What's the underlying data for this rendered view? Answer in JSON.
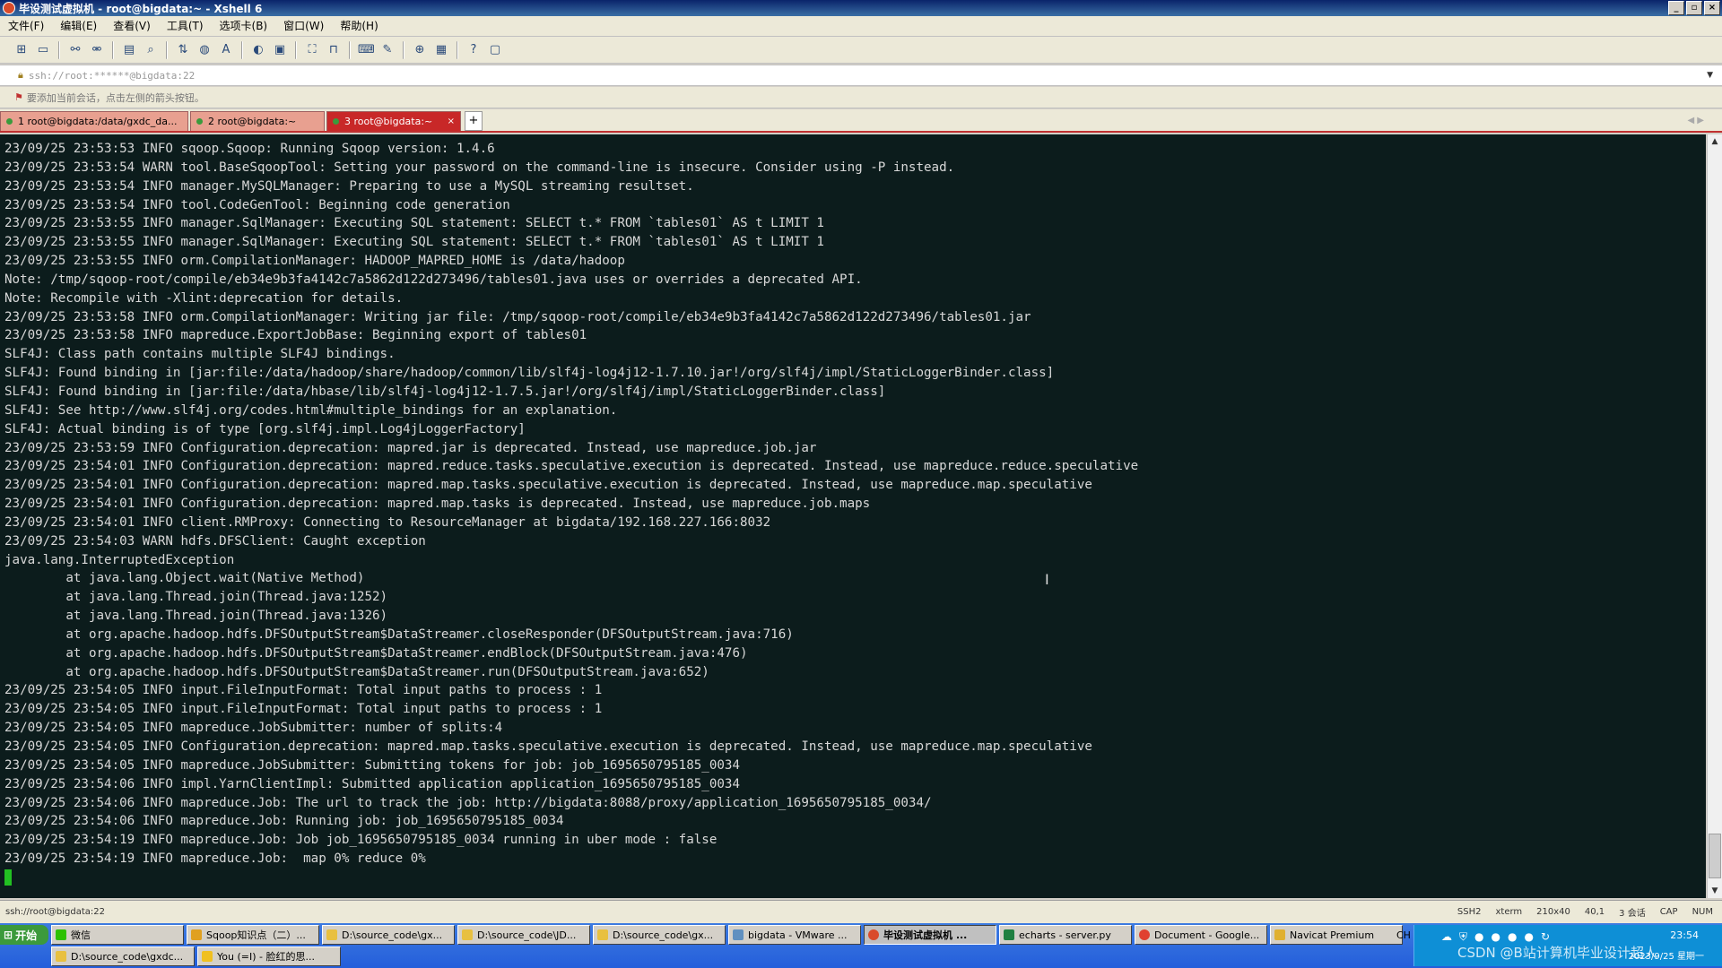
{
  "window": {
    "title": "毕设测试虚拟机 - root@bigdata:~ - Xshell 6",
    "minimize": "_",
    "maximize": "▫",
    "close": "×"
  },
  "menu": [
    "文件(F)",
    "编辑(E)",
    "查看(V)",
    "工具(T)",
    "选项卡(B)",
    "窗口(W)",
    "帮助(H)"
  ],
  "address": {
    "value": "ssh://root:******@bigdata:22"
  },
  "hint": {
    "text": "要添加当前会话，点击左侧的箭头按钮。"
  },
  "tabs": [
    {
      "label": "1 root@bigdata:/data/gxdc_da..."
    },
    {
      "label": "2 root@bigdata:~"
    },
    {
      "label": "3 root@bigdata:~",
      "close": "×"
    }
  ],
  "tab_add": "+",
  "terminal_lines": [
    "23/09/25 23:53:53 INFO sqoop.Sqoop: Running Sqoop version: 1.4.6",
    "23/09/25 23:53:54 WARN tool.BaseSqoopTool: Setting your password on the command-line is insecure. Consider using -P instead.",
    "23/09/25 23:53:54 INFO manager.MySQLManager: Preparing to use a MySQL streaming resultset.",
    "23/09/25 23:53:54 INFO tool.CodeGenTool: Beginning code generation",
    "23/09/25 23:53:55 INFO manager.SqlManager: Executing SQL statement: SELECT t.* FROM `tables01` AS t LIMIT 1",
    "23/09/25 23:53:55 INFO manager.SqlManager: Executing SQL statement: SELECT t.* FROM `tables01` AS t LIMIT 1",
    "23/09/25 23:53:55 INFO orm.CompilationManager: HADOOP_MAPRED_HOME is /data/hadoop",
    "Note: /tmp/sqoop-root/compile/eb34e9b3fa4142c7a5862d122d273496/tables01.java uses or overrides a deprecated API.",
    "Note: Recompile with -Xlint:deprecation for details.",
    "23/09/25 23:53:58 INFO orm.CompilationManager: Writing jar file: /tmp/sqoop-root/compile/eb34e9b3fa4142c7a5862d122d273496/tables01.jar",
    "23/09/25 23:53:58 INFO mapreduce.ExportJobBase: Beginning export of tables01",
    "SLF4J: Class path contains multiple SLF4J bindings.",
    "SLF4J: Found binding in [jar:file:/data/hadoop/share/hadoop/common/lib/slf4j-log4j12-1.7.10.jar!/org/slf4j/impl/StaticLoggerBinder.class]",
    "SLF4J: Found binding in [jar:file:/data/hbase/lib/slf4j-log4j12-1.7.5.jar!/org/slf4j/impl/StaticLoggerBinder.class]",
    "SLF4J: See http://www.slf4j.org/codes.html#multiple_bindings for an explanation.",
    "SLF4J: Actual binding is of type [org.slf4j.impl.Log4jLoggerFactory]",
    "23/09/25 23:53:59 INFO Configuration.deprecation: mapred.jar is deprecated. Instead, use mapreduce.job.jar",
    "23/09/25 23:54:01 INFO Configuration.deprecation: mapred.reduce.tasks.speculative.execution is deprecated. Instead, use mapreduce.reduce.speculative",
    "23/09/25 23:54:01 INFO Configuration.deprecation: mapred.map.tasks.speculative.execution is deprecated. Instead, use mapreduce.map.speculative",
    "23/09/25 23:54:01 INFO Configuration.deprecation: mapred.map.tasks is deprecated. Instead, use mapreduce.job.maps",
    "23/09/25 23:54:01 INFO client.RMProxy: Connecting to ResourceManager at bigdata/192.168.227.166:8032",
    "23/09/25 23:54:03 WARN hdfs.DFSClient: Caught exception",
    "java.lang.InterruptedException",
    "        at java.lang.Object.wait(Native Method)",
    "        at java.lang.Thread.join(Thread.java:1252)",
    "        at java.lang.Thread.join(Thread.java:1326)",
    "        at org.apache.hadoop.hdfs.DFSOutputStream$DataStreamer.closeResponder(DFSOutputStream.java:716)",
    "        at org.apache.hadoop.hdfs.DFSOutputStream$DataStreamer.endBlock(DFSOutputStream.java:476)",
    "        at org.apache.hadoop.hdfs.DFSOutputStream$DataStreamer.run(DFSOutputStream.java:652)",
    "23/09/25 23:54:05 INFO input.FileInputFormat: Total input paths to process : 1",
    "23/09/25 23:54:05 INFO input.FileInputFormat: Total input paths to process : 1",
    "23/09/25 23:54:05 INFO mapreduce.JobSubmitter: number of splits:4",
    "23/09/25 23:54:05 INFO Configuration.deprecation: mapred.map.tasks.speculative.execution is deprecated. Instead, use mapreduce.map.speculative",
    "23/09/25 23:54:05 INFO mapreduce.JobSubmitter: Submitting tokens for job: job_1695650795185_0034",
    "23/09/25 23:54:06 INFO impl.YarnClientImpl: Submitted application application_1695650795185_0034",
    "23/09/25 23:54:06 INFO mapreduce.Job: The url to track the job: http://bigdata:8088/proxy/application_1695650795185_0034/",
    "23/09/25 23:54:06 INFO mapreduce.Job: Running job: job_1695650795185_0034",
    "23/09/25 23:54:19 INFO mapreduce.Job: Job job_1695650795185_0034 running in uber mode : false",
    "23/09/25 23:54:19 INFO mapreduce.Job:  map 0% reduce 0%"
  ],
  "status": {
    "address": "ssh://root@bigdata:22",
    "items": [
      "SSH2",
      "xterm",
      "210x40",
      "40,1",
      "3 会话",
      "CAP",
      "NUM"
    ]
  },
  "taskbar": {
    "start": "开始",
    "row1": [
      "微信",
      "Sqoop知识点（二）...",
      "D:\\source_code\\gx...",
      "D:\\source_code\\JD...",
      "D:\\source_code\\gx...",
      "bigdata - VMware ...",
      "毕设测试虚拟机 ...",
      "echarts - server.py",
      "Document - Google...",
      "Navicat Premium"
    ],
    "row2": [
      "D:\\source_code\\gxdc...",
      "You (=I) - 脸红的思..."
    ],
    "ime": "CH",
    "time": "23:54",
    "date": "2023/9/25 星期一",
    "watermark": "CSDN @B站计算机毕业设计超人"
  }
}
